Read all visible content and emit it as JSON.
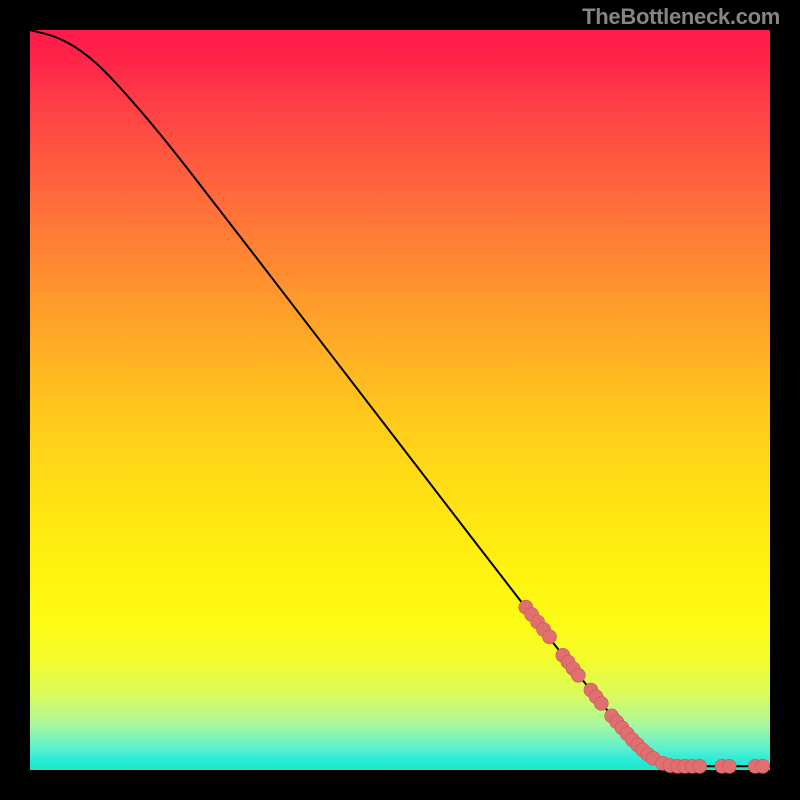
{
  "attribution": "TheBottleneck.com",
  "chart_data": {
    "type": "line",
    "title": "",
    "xlabel": "",
    "ylabel": "",
    "xlim": [
      0,
      100
    ],
    "ylim": [
      0,
      100
    ],
    "background_gradient": [
      "#ff1a4a",
      "#ff9b2c",
      "#fff40e",
      "#20e7b8"
    ],
    "curve": [
      {
        "x": 0,
        "y": 100
      },
      {
        "x": 4,
        "y": 99
      },
      {
        "x": 8,
        "y": 96.5
      },
      {
        "x": 12,
        "y": 92.5
      },
      {
        "x": 18,
        "y": 85.5
      },
      {
        "x": 25,
        "y": 76.5
      },
      {
        "x": 35,
        "y": 63.5
      },
      {
        "x": 45,
        "y": 50.5
      },
      {
        "x": 55,
        "y": 37.5
      },
      {
        "x": 65,
        "y": 24.5
      },
      {
        "x": 72,
        "y": 15.5
      },
      {
        "x": 78,
        "y": 8.0
      },
      {
        "x": 82,
        "y": 3.5
      },
      {
        "x": 85,
        "y": 1.2
      },
      {
        "x": 88,
        "y": 0.5
      },
      {
        "x": 92,
        "y": 0.5
      },
      {
        "x": 100,
        "y": 0.5
      }
    ],
    "scatter": [
      {
        "x": 67.0,
        "y": 22.0
      },
      {
        "x": 67.8,
        "y": 21.0
      },
      {
        "x": 68.6,
        "y": 20.0
      },
      {
        "x": 69.4,
        "y": 19.0
      },
      {
        "x": 70.2,
        "y": 18.0
      },
      {
        "x": 72.0,
        "y": 15.5
      },
      {
        "x": 72.7,
        "y": 14.6
      },
      {
        "x": 73.4,
        "y": 13.7
      },
      {
        "x": 74.1,
        "y": 12.8
      },
      {
        "x": 75.8,
        "y": 10.8
      },
      {
        "x": 76.5,
        "y": 9.9
      },
      {
        "x": 77.2,
        "y": 9.0
      },
      {
        "x": 78.6,
        "y": 7.3
      },
      {
        "x": 79.3,
        "y": 6.5
      },
      {
        "x": 80.0,
        "y": 5.7
      },
      {
        "x": 80.7,
        "y": 4.9
      },
      {
        "x": 81.4,
        "y": 4.1
      },
      {
        "x": 82.1,
        "y": 3.4
      },
      {
        "x": 82.8,
        "y": 2.7
      },
      {
        "x": 83.5,
        "y": 2.1
      },
      {
        "x": 84.2,
        "y": 1.6
      },
      {
        "x": 85.5,
        "y": 0.9
      },
      {
        "x": 86.5,
        "y": 0.6
      },
      {
        "x": 87.5,
        "y": 0.5
      },
      {
        "x": 88.5,
        "y": 0.5
      },
      {
        "x": 89.5,
        "y": 0.5
      },
      {
        "x": 90.5,
        "y": 0.5
      },
      {
        "x": 93.5,
        "y": 0.5
      },
      {
        "x": 94.5,
        "y": 0.5
      },
      {
        "x": 98.0,
        "y": 0.5
      },
      {
        "x": 99.0,
        "y": 0.5
      }
    ]
  }
}
